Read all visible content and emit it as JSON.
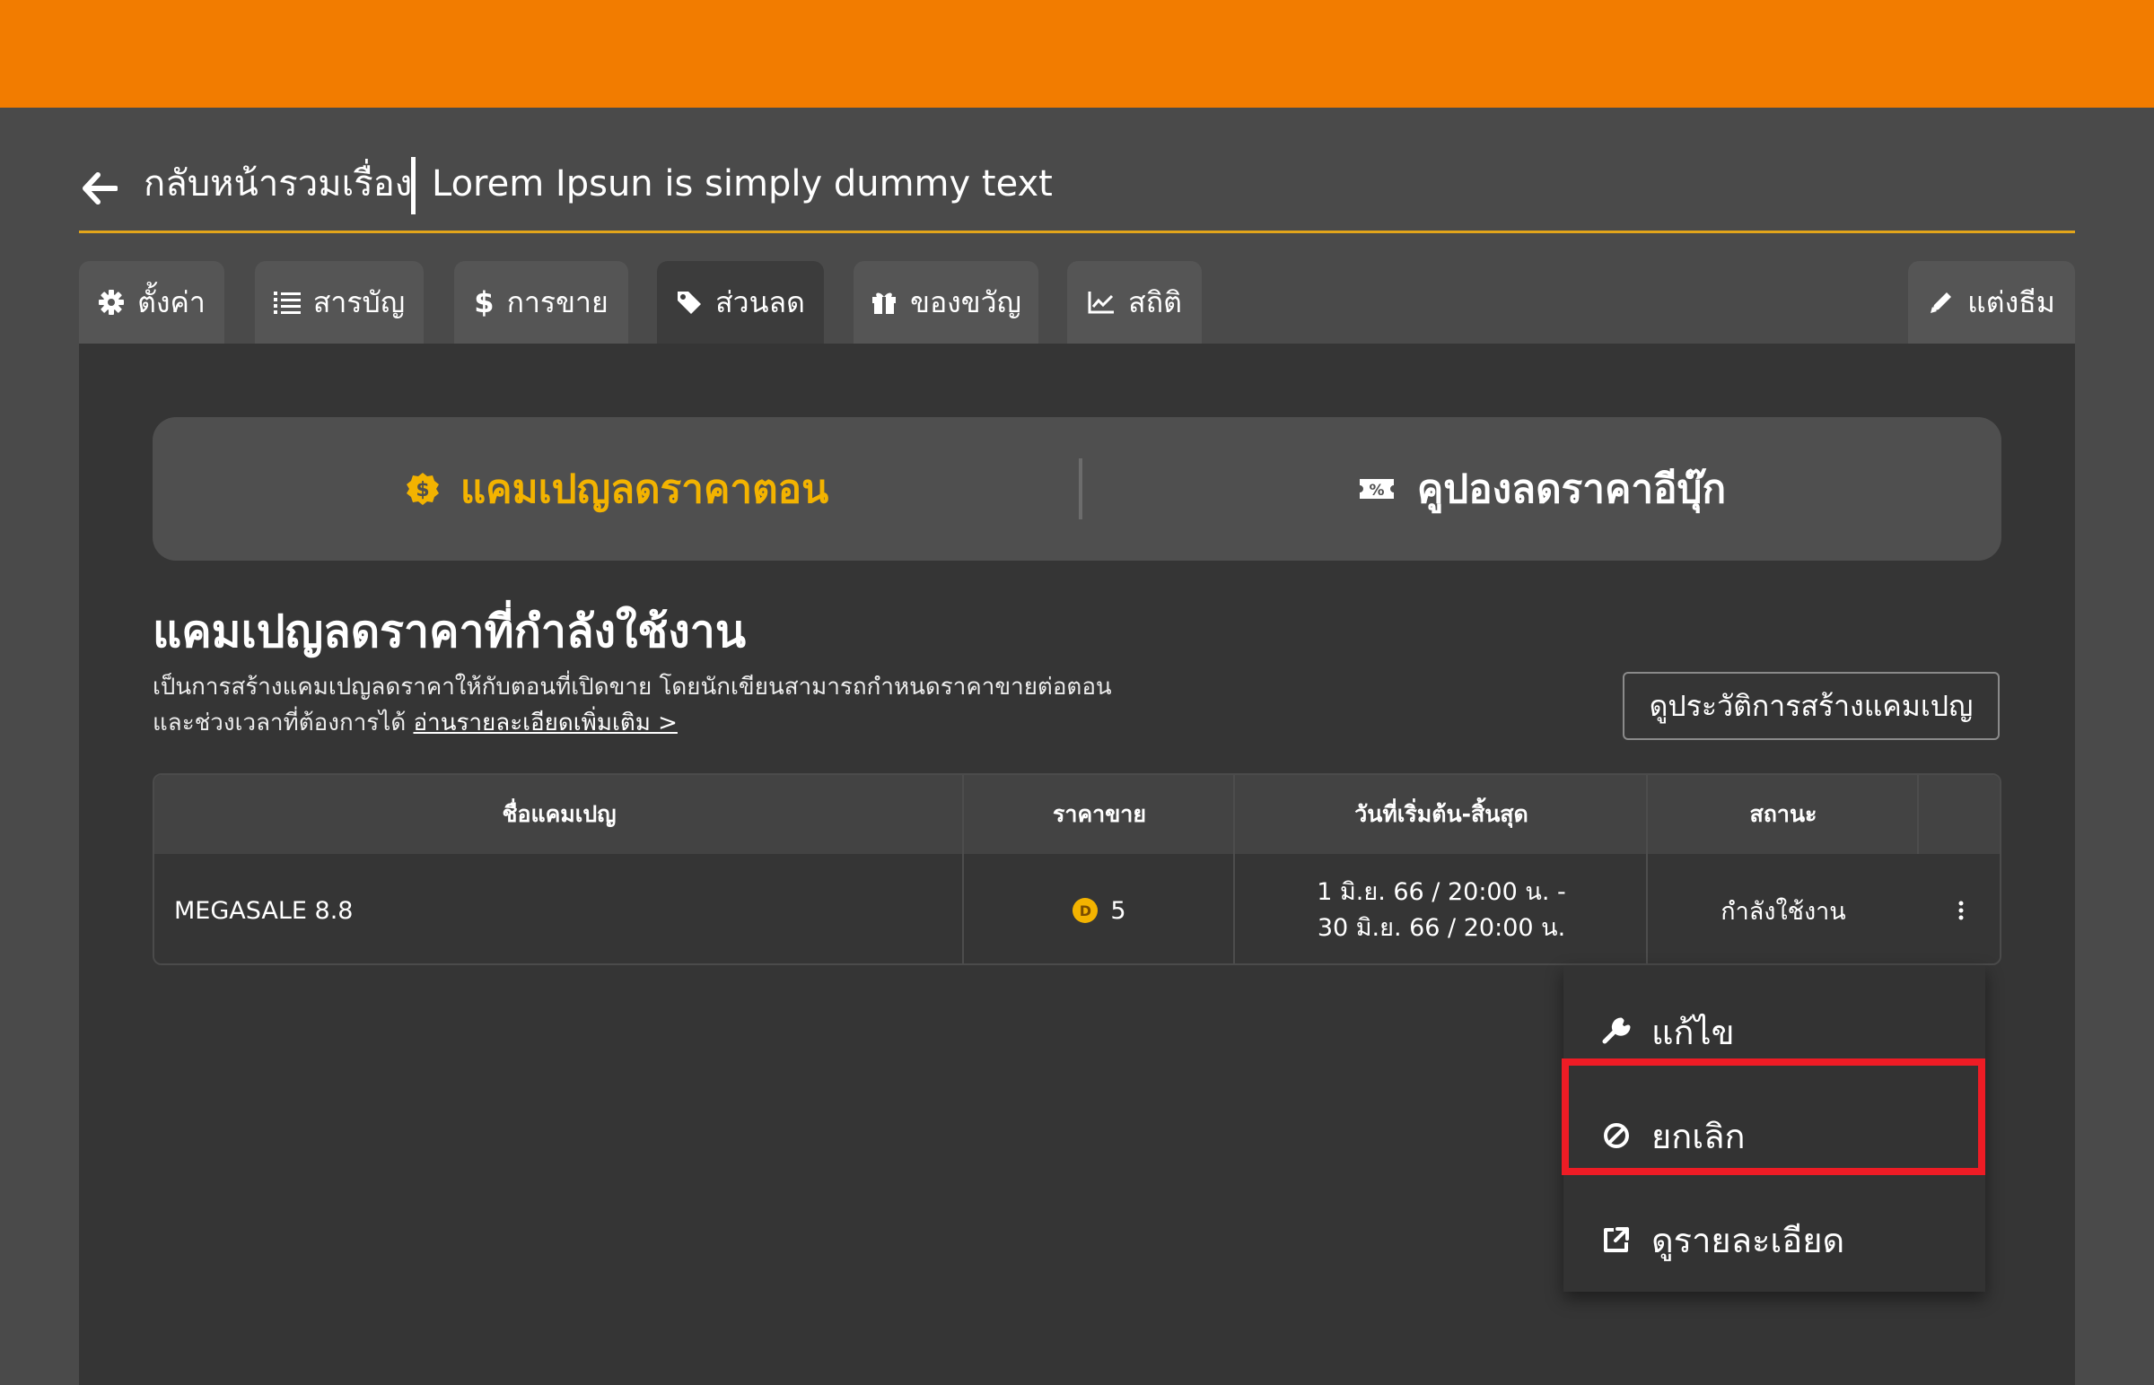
{
  "header": {
    "back_label": "กลับหน้ารวมเรื่อง",
    "story_title": "Lorem Ipsun is simply dummy text",
    "accent_line_color": "#e3a51a"
  },
  "tabs": [
    {
      "label": "ตั้งค่า",
      "icon": "gear-icon"
    },
    {
      "label": "สารบัญ",
      "icon": "list-icon"
    },
    {
      "label": "การขาย",
      "icon": "dollar-icon"
    },
    {
      "label": "ส่วนลด",
      "icon": "tag-icon",
      "active": true
    },
    {
      "label": "ของขวัญ",
      "icon": "gift-icon"
    },
    {
      "label": "สถิติ",
      "icon": "chart-line-icon"
    },
    {
      "label": "แต่งธีม",
      "icon": "pencil-icon"
    }
  ],
  "segments": {
    "left_label": "แคมเปญลดราคาตอน",
    "right_label": "คูปองลดราคาอีบุ๊ก",
    "active_color": "#f3b300"
  },
  "section": {
    "title": "แคมเปญลดราคาที่กำลังใช้งาน",
    "desc_line1": "เป็นการสร้างแคมเปญลดราคาให้กับตอนที่เปิดขาย โดยนักเขียนสามารถกำหนดราคาขายต่อตอน",
    "desc_line2": "และช่วงเวลาที่ต้องการได้",
    "read_more": "อ่านรายละเอียดเพิ่มเติม >",
    "history_button": "ดูประวัติการสร้างแคมเปญ"
  },
  "table": {
    "columns": [
      "ชื่อแคมเปญ",
      "ราคาขาย",
      "วันที่เริ่มต้น-สิ้นสุด",
      "สถานะ"
    ],
    "rows": [
      {
        "name": "MEGASALE 8.8",
        "price": "5",
        "coin_letter": "D",
        "date_start": "1 มิ.ย. 66 / 20:00 น. -",
        "date_end": "30 มิ.ย. 66 / 20:00 น.",
        "status": "กำลังใช้งาน"
      }
    ]
  },
  "menu": {
    "items": [
      {
        "label": "แก้ไข",
        "icon": "wrench-icon"
      },
      {
        "label": "ยกเลิก",
        "icon": "ban-icon",
        "highlighted": true
      },
      {
        "label": "ดูรายละเอียด",
        "icon": "external-link-icon"
      }
    ],
    "highlight_color": "#ee1c25"
  },
  "colors": {
    "topbar": "#f27c00",
    "background": "#4a4a4a",
    "panel": "#353535"
  }
}
